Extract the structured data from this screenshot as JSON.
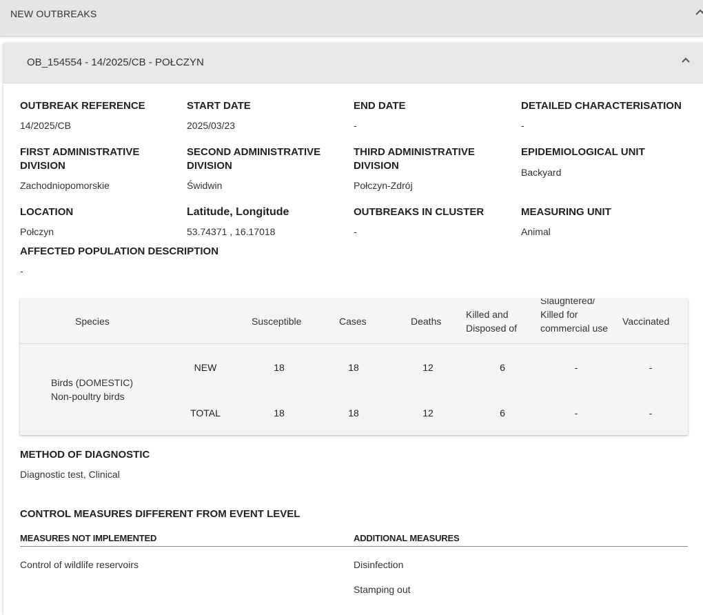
{
  "top_section": {
    "title": "NEW OUTBREAKS"
  },
  "outbreak": {
    "header": "OB_154554 - 14/2025/CB - POŁCZYN",
    "fields": {
      "outbreak_reference": {
        "label": "OUTBREAK REFERENCE",
        "value": "14/2025/CB"
      },
      "start_date": {
        "label": "START DATE",
        "value": "2025/03/23"
      },
      "end_date": {
        "label": "END DATE",
        "value": "-"
      },
      "detailed_characterisation": {
        "label": "DETAILED CHARACTERISATION",
        "value": "-"
      },
      "first_admin_division": {
        "label": "FIRST ADMINISTRATIVE DIVISION",
        "value": "Zachodniopomorskie"
      },
      "second_admin_division": {
        "label": "SECOND ADMINISTRATIVE DIVISION",
        "value": "Świdwin"
      },
      "third_admin_division": {
        "label": "THIRD ADMINISTRATIVE DIVISION",
        "value": "Połczyn-Zdrój"
      },
      "epidemiological_unit": {
        "label": "EPIDEMIOLOGICAL UNIT",
        "value": "Backyard"
      },
      "location": {
        "label": "LOCATION",
        "value": "Połczyn"
      },
      "lat_long": {
        "label": "Latitude, Longitude",
        "value": "53.74371 , 16.17018"
      },
      "outbreaks_in_cluster": {
        "label": "OUTBREAKS IN CLUSTER",
        "value": "-"
      },
      "measuring_unit": {
        "label": "MEASURING UNIT",
        "value": "Animal"
      },
      "affected_population": {
        "label": "AFFECTED POPULATION DESCRIPTION",
        "value": "-"
      }
    },
    "species_table": {
      "headers": {
        "species": "Species",
        "susceptible": "Susceptible",
        "cases": "Cases",
        "deaths": "Deaths",
        "killed_disposed": "Killed and Disposed of",
        "slaughtered": "Slaughtered/ Killed for commercial use",
        "vaccinated": "Vaccinated"
      },
      "species_name": "Birds (DOMESTIC) Non-poultry birds",
      "rows": [
        {
          "label": "NEW",
          "susceptible": "18",
          "cases": "18",
          "deaths": "12",
          "killed_disposed": "6",
          "slaughtered": "-",
          "vaccinated": "-"
        },
        {
          "label": "TOTAL",
          "susceptible": "18",
          "cases": "18",
          "deaths": "12",
          "killed_disposed": "6",
          "slaughtered": "-",
          "vaccinated": "-"
        }
      ]
    },
    "diagnostic": {
      "label": "METHOD OF DIAGNOSTIC",
      "value": "Diagnostic test, Clinical"
    },
    "control_measures": {
      "title": "CONTROL MEASURES DIFFERENT FROM EVENT LEVEL",
      "not_implemented": {
        "label": "MEASURES NOT IMPLEMENTED",
        "items": [
          "Control of wildlife reservoirs"
        ]
      },
      "additional": {
        "label": "ADDITIONAL MEASURES",
        "items": [
          "Disinfection",
          "Stamping out"
        ]
      }
    }
  }
}
